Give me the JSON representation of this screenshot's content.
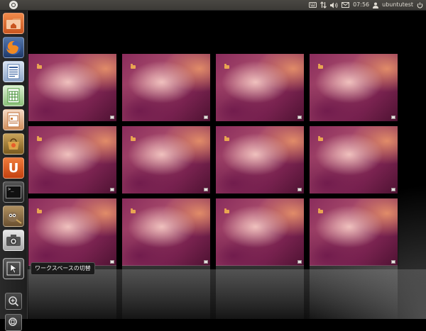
{
  "top_panel": {
    "clock": "07:56",
    "username": "ubuntutest",
    "indicators": [
      "keyboard-icon",
      "network-icon",
      "volume-icon",
      "mail-icon"
    ]
  },
  "launcher": {
    "items": [
      {
        "name": "home-folder",
        "icon": "home-folder-icon"
      },
      {
        "name": "firefox",
        "icon": "firefox-icon"
      },
      {
        "name": "libreoffice-writer",
        "icon": "writer-icon"
      },
      {
        "name": "libreoffice-calc",
        "icon": "calc-icon"
      },
      {
        "name": "libreoffice-impress",
        "icon": "impress-icon"
      },
      {
        "name": "software-center",
        "icon": "software-center-icon"
      },
      {
        "name": "ubuntu-one",
        "icon": "ubuntu-one-icon"
      },
      {
        "name": "terminal",
        "icon": "terminal-icon"
      },
      {
        "name": "gimp",
        "icon": "gimp-icon"
      },
      {
        "name": "screenshot",
        "icon": "screenshot-icon"
      },
      {
        "name": "workspace-switcher",
        "icon": "workspace-switcher-icon"
      },
      {
        "name": "applications-lens",
        "icon": "applications-icon"
      },
      {
        "name": "files-lens",
        "icon": "files-icon"
      }
    ],
    "tooltip": "ワークスペースの切替",
    "ubuntu_one_letter": "U",
    "terminal_prompt": ">_"
  },
  "workspaces": {
    "rows": 3,
    "cols": 4,
    "count": 12
  },
  "colors": {
    "panel": "#3c3b37",
    "launcher": "#262626",
    "wallpaper_primary": "#8a2c5c",
    "wallpaper_highlight": "#ffd7cd"
  }
}
